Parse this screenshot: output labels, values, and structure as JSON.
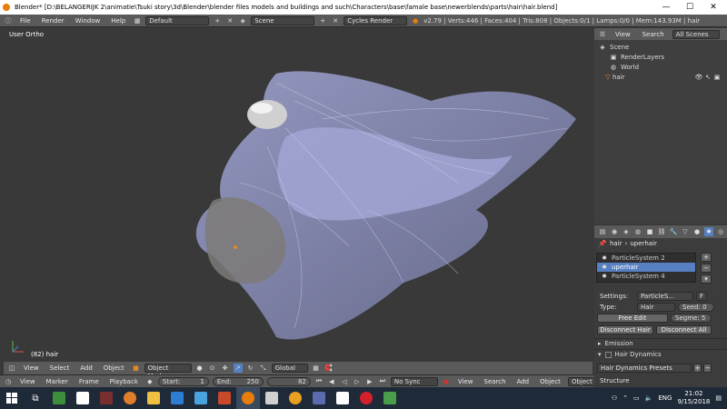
{
  "window": {
    "title": "Blender* [D:\\BELANGERIJK 2\\animatie\\Tsuki story\\3d\\Blender\\blender files models and buildings and such\\Characters\\base\\famale base\\newerblends\\parts\\hair\\hair.blend]",
    "minimize": "—",
    "maximize": "☐",
    "close": "✕"
  },
  "topbar": {
    "menus": [
      "File",
      "Render",
      "Window",
      "Help"
    ],
    "layout": "Default",
    "scene": "Scene",
    "engine": "Cycles Render",
    "stats": "v2.79 | Verts:446 | Faces:404 | Tris:808 | Objects:0/1 | Lamps:0/0 | Mem:143.93M | hair"
  },
  "viewport": {
    "view_label": "User Ortho",
    "object_label": "(82) hair"
  },
  "view_header": {
    "menus": [
      "View",
      "Select",
      "Add",
      "Object"
    ],
    "mode": "Object Mode",
    "orientation": "Global"
  },
  "timeline": {
    "menus": [
      "View",
      "Marker",
      "Frame",
      "Playback"
    ],
    "start_label": "Start:",
    "start": "1",
    "end_label": "End:",
    "end": "250",
    "current": "82",
    "sync": "No Sync",
    "right_menus": [
      "View",
      "Search",
      "Add",
      "Object"
    ],
    "right_mode": "Object Mode"
  },
  "outliner": {
    "menus": [
      "View",
      "Search"
    ],
    "filter": "All Scenes",
    "items": [
      "Scene",
      "RenderLayers",
      "World",
      "hair"
    ]
  },
  "properties": {
    "breadcrumb_obj": "hair",
    "breadcrumb_psys": "uperhair",
    "systems": [
      "ParticleSystem 2",
      "uperhair",
      "ParticleSystem 4"
    ],
    "settings_label": "Settings:",
    "settings_value": "ParticleS...",
    "settings_count": "F",
    "type_label": "Type:",
    "type_value": "Hair",
    "seed": "Seed: 0",
    "segments": "Segme: 5",
    "free_edit": "Free Edit",
    "disconnect_hair": "Disconnect Hair",
    "disconnect_all": "Disconnect All",
    "panels": [
      "Emission",
      "Hair Dynamics"
    ],
    "presets": "Hair Dynamics Presets",
    "structure": "Structure"
  },
  "taskbar": {
    "time": "21:02",
    "date": "9/15/2018",
    "lang": "ENG"
  },
  "colors": {
    "accent": "#5680c2",
    "hair": "#8f95c7",
    "background": "#393939",
    "panel": "#5a5a5a"
  }
}
